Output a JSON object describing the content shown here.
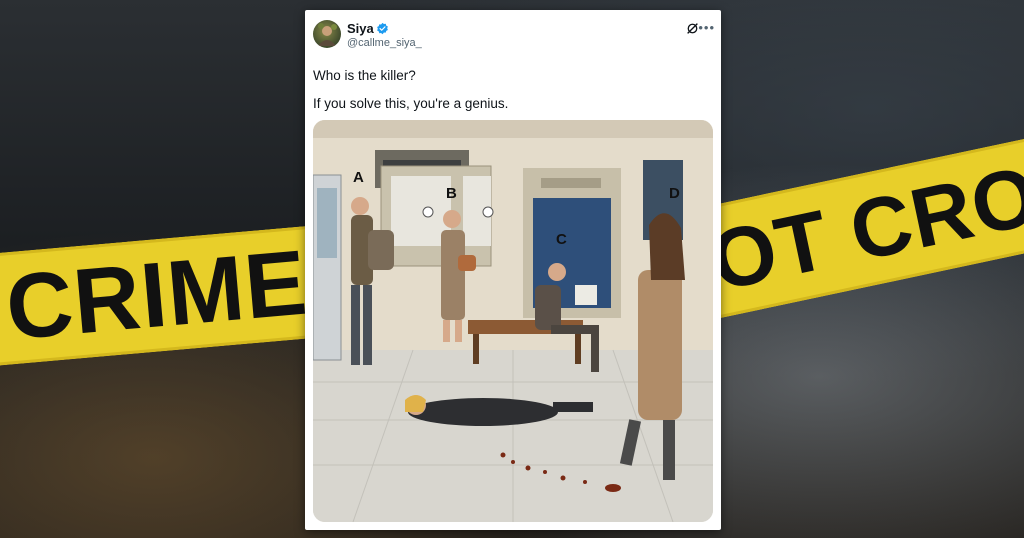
{
  "background": {
    "tape_left_text": "CRIME S",
    "tape_right_text": "OT CROSS",
    "tape_color": "#e8cf2a"
  },
  "post": {
    "author_name": "Siya",
    "author_handle": "@callme_siya_",
    "verified_color": "#1d9bf0",
    "line1": "Who is the killer?",
    "line2": "If you solve this, you're a genius."
  },
  "illustration": {
    "labels": [
      "A",
      "B",
      "C",
      "D"
    ]
  }
}
